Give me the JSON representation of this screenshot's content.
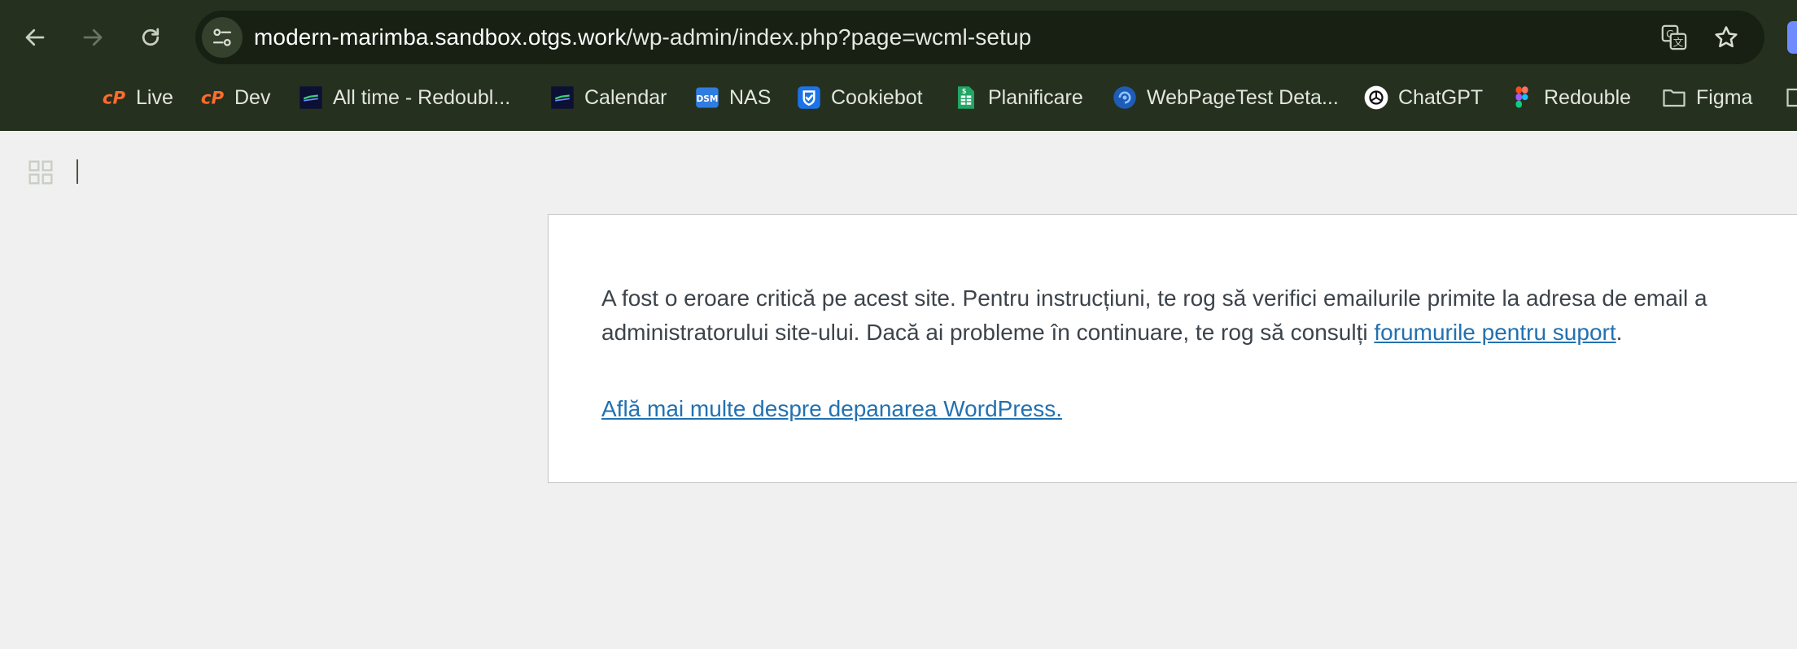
{
  "browser": {
    "url_host": "modern-marimba.sandbox.otgs.work",
    "url_path": "/wp-admin/index.php?page=wcml-setup",
    "icons": [
      "back-arrow-icon",
      "forward-arrow-icon",
      "reload-icon",
      "site-info-icon",
      "translate-icon",
      "bookmark-star-icon"
    ]
  },
  "bookmarks": [
    {
      "label": "Live",
      "icon": "cpanel-icon"
    },
    {
      "label": "Dev",
      "icon": "cpanel-icon"
    },
    {
      "label": "All time - Redoubl...",
      "icon": "redouble-dashboard-icon"
    },
    {
      "label": "Calendar",
      "icon": "redouble-dashboard-icon"
    },
    {
      "label": "NAS",
      "icon": "dsm-icon"
    },
    {
      "label": "Cookiebot",
      "icon": "cookiebot-icon"
    },
    {
      "label": "Planificare",
      "icon": "google-sheets-icon"
    },
    {
      "label": "WebPageTest Deta...",
      "icon": "webpagetest-icon"
    },
    {
      "label": "ChatGPT",
      "icon": "chatgpt-icon"
    },
    {
      "label": "Redouble",
      "icon": "figma-icon"
    },
    {
      "label": "Figma",
      "icon": "folder-icon"
    }
  ],
  "page": {
    "error_text": "A fost o eroare critică pe acest site. Pentru instrucțiuni, te rog să verifici emailurile primite la adresa de email a administratorului site-ului. Dacă ai probleme în continuare, te rog să consulți ",
    "forum_link": "forumurile pentru suport",
    "error_end": ".",
    "learn_more_link": "Află mai multe despre depanarea WordPress."
  },
  "colors": {
    "chrome_bg": "#26301f",
    "omnibox_bg": "#172013",
    "page_bg": "#f0f0f1",
    "link": "#2271b1",
    "text": "#3c434a"
  }
}
